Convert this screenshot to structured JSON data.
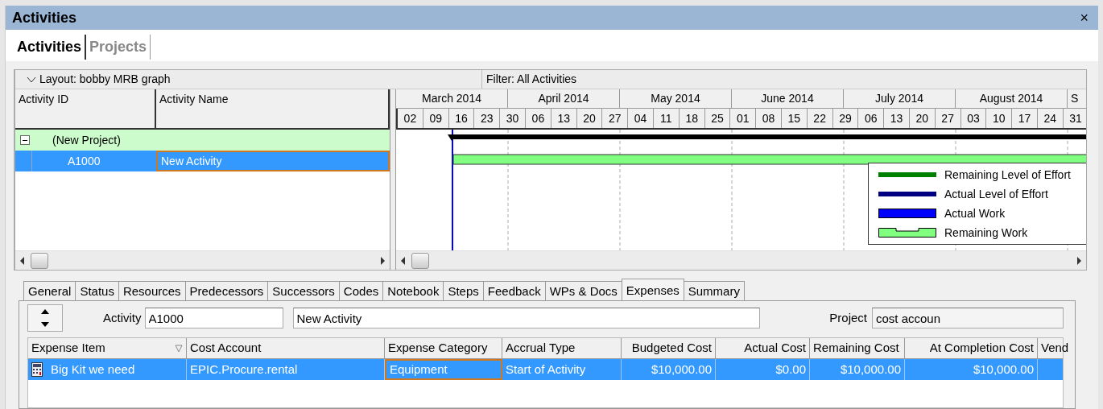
{
  "window": {
    "title": "Activities",
    "close": "×"
  },
  "view_tabs": [
    {
      "label": "Activities",
      "selected": true
    },
    {
      "label": "Projects",
      "selected": false
    }
  ],
  "layout": {
    "label": "Layout: bobby MRB graph",
    "expanded": true
  },
  "filter": "Filter: All Activities",
  "grid": {
    "columns": [
      "Activity ID",
      "Activity Name"
    ],
    "rows": [
      {
        "kind": "project",
        "id": "(New Project)",
        "expanded": true,
        "selected": false
      },
      {
        "kind": "activity",
        "id": "A1000",
        "name": "New Activity",
        "selected": true
      }
    ]
  },
  "gantt": {
    "months": [
      "March 2014",
      "April 2014",
      "May 2014",
      "June 2014",
      "July 2014",
      "August 2014",
      "S"
    ],
    "weeks": [
      "02",
      "09",
      "16",
      "23",
      "30",
      "06",
      "13",
      "20",
      "27",
      "04",
      "11",
      "18",
      "25",
      "01",
      "08",
      "15",
      "22",
      "29",
      "06",
      "13",
      "20",
      "27",
      "03",
      "10",
      "17",
      "24",
      "31"
    ],
    "legend": [
      {
        "label": "Remaining Level of Effort",
        "kind": "line",
        "color": "#008000"
      },
      {
        "label": "Actual Level of Effort",
        "kind": "line",
        "color": "#000080"
      },
      {
        "label": "Actual Work",
        "kind": "bar",
        "color": "#0000ff"
      },
      {
        "label": "Remaining Work",
        "kind": "notched",
        "color": "#80ff80"
      }
    ]
  },
  "detail_tabs": [
    {
      "label": "General",
      "selected": false
    },
    {
      "label": "Status",
      "selected": false
    },
    {
      "label": "Resources",
      "selected": false
    },
    {
      "label": "Predecessors",
      "selected": false
    },
    {
      "label": "Successors",
      "selected": false
    },
    {
      "label": "Codes",
      "selected": false
    },
    {
      "label": "Notebook",
      "selected": false
    },
    {
      "label": "Steps",
      "selected": false
    },
    {
      "label": "Feedback",
      "selected": false
    },
    {
      "label": "WPs & Docs",
      "selected": false
    },
    {
      "label": "Expenses",
      "selected": true
    },
    {
      "label": "Summary",
      "selected": false
    }
  ],
  "activity_form": {
    "activity_label": "Activity",
    "activity_id": "A1000",
    "activity_name": "New Activity",
    "project_label": "Project",
    "project": "cost accoun"
  },
  "expenses": {
    "columns": [
      "Expense Item",
      "Cost Account",
      "Expense Category",
      "Accrual Type",
      "Budgeted Cost",
      "Actual Cost",
      "Remaining Cost",
      "At Completion Cost",
      "Vend"
    ],
    "rows": [
      {
        "selected": true,
        "cells": [
          "Big Kit we need",
          "EPIC.Procure.rental",
          "Equipment",
          "Start of Activity",
          "$10,000.00",
          "$0.00",
          "$10,000.00",
          "$10,000.00",
          ""
        ]
      }
    ]
  }
}
